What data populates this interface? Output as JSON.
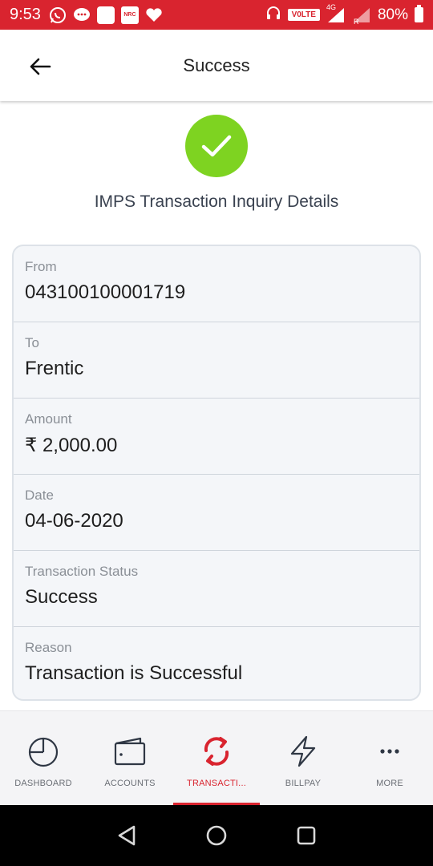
{
  "status_bar": {
    "time": "9:53",
    "volte": "V0LTE",
    "network": "4G",
    "roaming": "R",
    "battery": "80%",
    "nrc_badge": "NRC",
    "icons": [
      "whatsapp-icon",
      "message-icon",
      "square-notification-icon",
      "nrc-icon",
      "heart-icon",
      "headphones-icon",
      "signal-icon",
      "battery-icon"
    ]
  },
  "header": {
    "title": "Success"
  },
  "result": {
    "title": "IMPS Transaction Inquiry Details"
  },
  "details": [
    {
      "label": "From",
      "value": "043100100001719"
    },
    {
      "label": "To",
      "value": "Frentic"
    },
    {
      "label": "Amount",
      "value": "₹ 2,000.00"
    },
    {
      "label": "Date",
      "value": "04-06-2020"
    },
    {
      "label": "Transaction Status",
      "value": "Success"
    },
    {
      "label": "Reason",
      "value": "Transaction is Successful"
    }
  ],
  "bottom_nav": [
    {
      "label": "DASHBOARD",
      "icon": "pie-chart-icon",
      "active": false
    },
    {
      "label": "ACCOUNTS",
      "icon": "wallet-icon",
      "active": false
    },
    {
      "label": "TRANSACTI...",
      "icon": "transfer-arrows-icon",
      "active": true
    },
    {
      "label": "BILLPAY",
      "icon": "lightning-icon",
      "active": false
    },
    {
      "label": "MORE",
      "icon": "more-dots-icon",
      "active": false
    }
  ],
  "colors": {
    "brand_red": "#d9242f",
    "success_green": "#7ed321",
    "card_bg": "#f4f6f9"
  }
}
